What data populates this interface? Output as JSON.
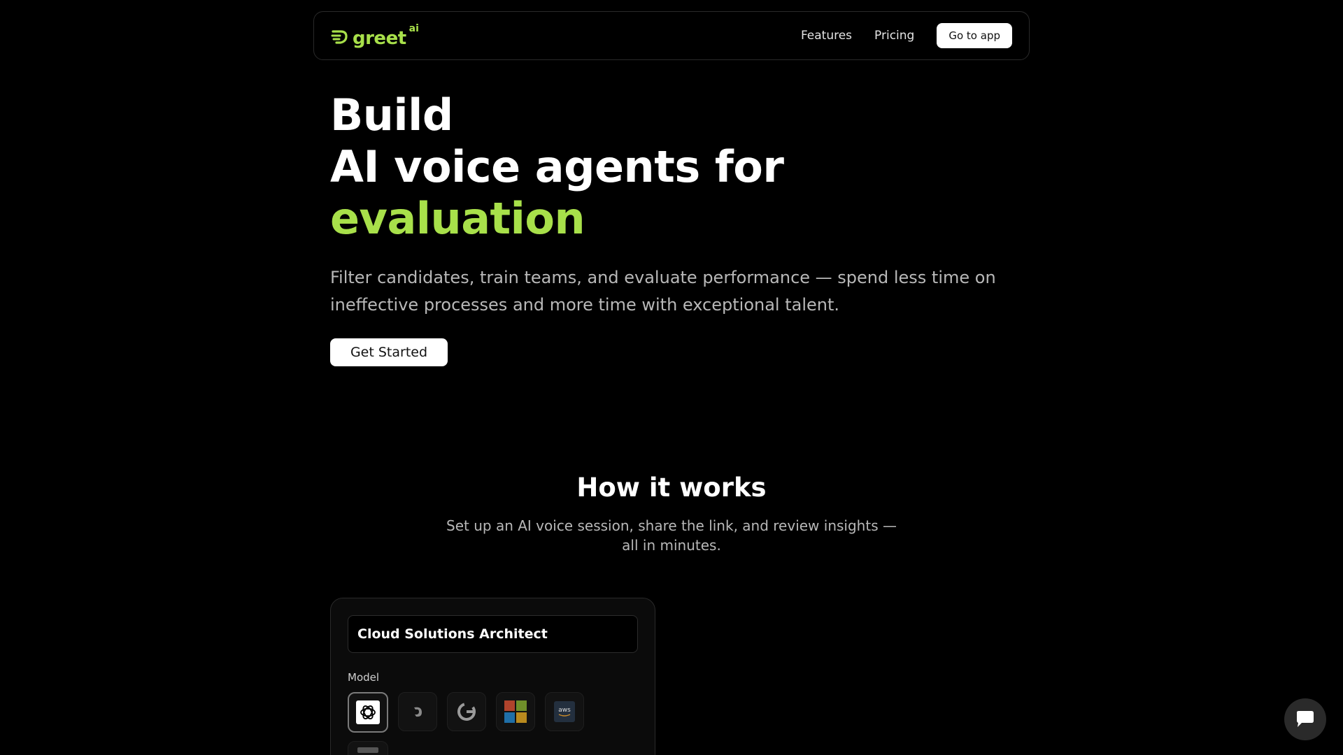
{
  "brand": {
    "name": "greet",
    "superscript": "ai",
    "accent_color": "#a8e04a",
    "icon": "swirl-logo-icon"
  },
  "nav": {
    "links": [
      "Features",
      "Pricing"
    ],
    "cta_label": "Go to app"
  },
  "hero": {
    "line1": "Build",
    "line2": "AI voice agents for",
    "line3_accent": "evaluation",
    "subtitle": "Filter candidates, train teams, and evaluate performance — spend less time on ineffective processes and more time with exceptional talent.",
    "cta_label": "Get Started"
  },
  "how_it_works": {
    "title": "How it works",
    "subtitle": "Set up an AI voice session, share the link, and review insights — all in minutes."
  },
  "card": {
    "title": "Cloud Solutions Architect",
    "model_label": "Model",
    "models": [
      {
        "icon": "openai-icon",
        "selected": true
      },
      {
        "icon": "deepseek-icon",
        "selected": false
      },
      {
        "icon": "google-icon",
        "selected": false
      },
      {
        "icon": "microsoft-icon",
        "selected": false
      },
      {
        "icon": "aws-icon",
        "selected": false
      }
    ],
    "aws_text": "aws"
  },
  "chat": {
    "icon": "chat-bubble-icon"
  }
}
